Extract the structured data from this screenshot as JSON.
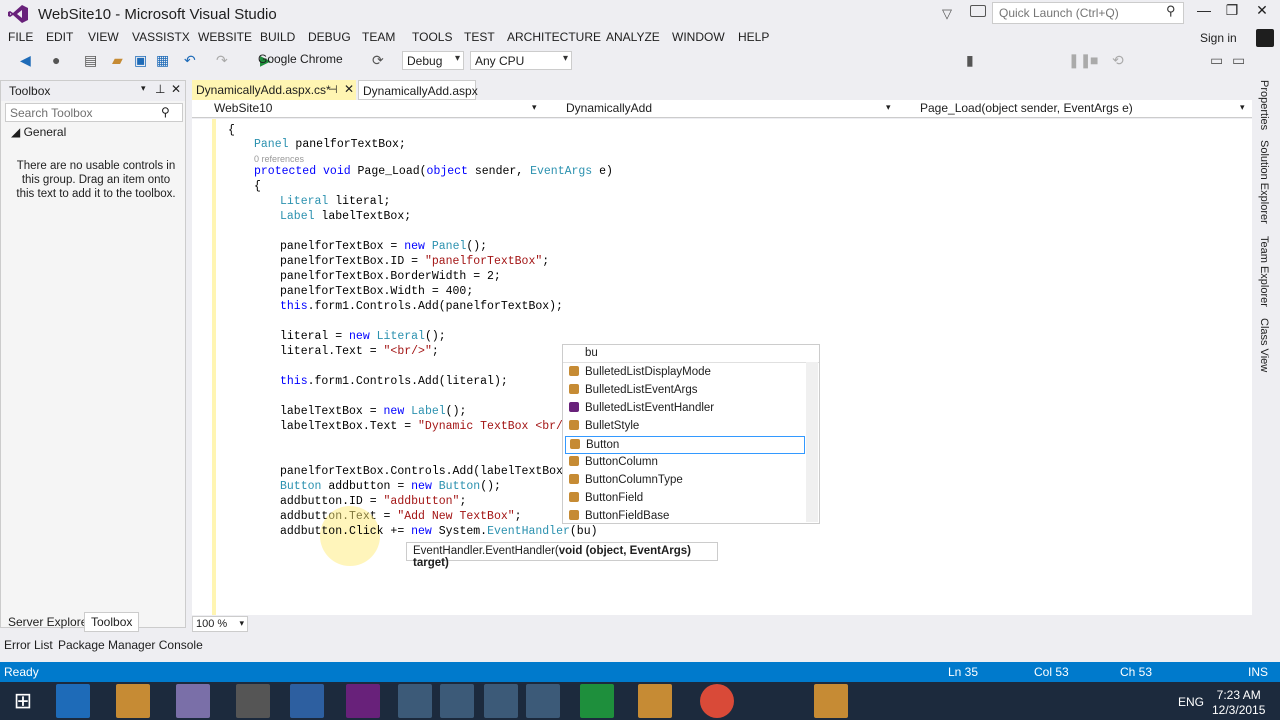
{
  "window": {
    "title": "WebSite10 - Microsoft Visual Studio"
  },
  "quick_launch": {
    "placeholder": "Quick Launch (Ctrl+Q)"
  },
  "menu": [
    "FILE",
    "EDIT",
    "VIEW",
    "VASSISTX",
    "WEBSITE",
    "BUILD",
    "DEBUG",
    "TEAM",
    "TOOLS",
    "TEST",
    "ARCHITECTURE",
    "ANALYZE",
    "WINDOW",
    "HELP"
  ],
  "signin": "Sign in",
  "toolbar": {
    "run_target": "Google Chrome",
    "config": "Debug",
    "platform": "Any CPU"
  },
  "toolbox": {
    "title": "Toolbox",
    "search_placeholder": "Search Toolbox",
    "group": "General",
    "empty_message": "There are no usable controls in this group. Drag an item onto this text to add it to the toolbox."
  },
  "bottom_tabs": {
    "server_explorer": "Server Explorer",
    "toolbox": "Toolbox",
    "error_list": "Error List",
    "package_manager": "Package Manager Console"
  },
  "doc_tabs": [
    {
      "label": "DynamicallyAdd.aspx.cs*"
    },
    {
      "label": "DynamicallyAdd.aspx"
    }
  ],
  "navbar": {
    "project": "WebSite10",
    "class": "DynamicallyAdd",
    "member": "Page_Load(object sender, EventArgs e)"
  },
  "code": {
    "refs": "0 references"
  },
  "intellisense": {
    "filter": "bu",
    "items": [
      "BulletedListDisplayMode",
      "BulletedListEventArgs",
      "BulletedListEventHandler",
      "BulletStyle",
      "Button",
      "ButtonColumn",
      "ButtonColumnType",
      "ButtonField",
      "ButtonFieldBase"
    ],
    "selected": "Button"
  },
  "tooltip": {
    "prefix": "EventHandler.EventHandler(",
    "signature": "void (object, EventArgs) target)"
  },
  "right_tabs": [
    "Properties",
    "Solution Explorer",
    "Team Explorer",
    "Class View"
  ],
  "zoom": "100 %",
  "status": {
    "state": "Ready",
    "ln": "Ln 35",
    "col": "Col 53",
    "ch": "Ch 53",
    "mode": "INS"
  },
  "taskbar": {
    "lang": "ENG",
    "time": "7:23 AM",
    "date": "12/3/2015"
  },
  "colors": {
    "accent": "#007acc",
    "vs_purple": "#68217a",
    "tab_yellow": "#fff5b2"
  }
}
